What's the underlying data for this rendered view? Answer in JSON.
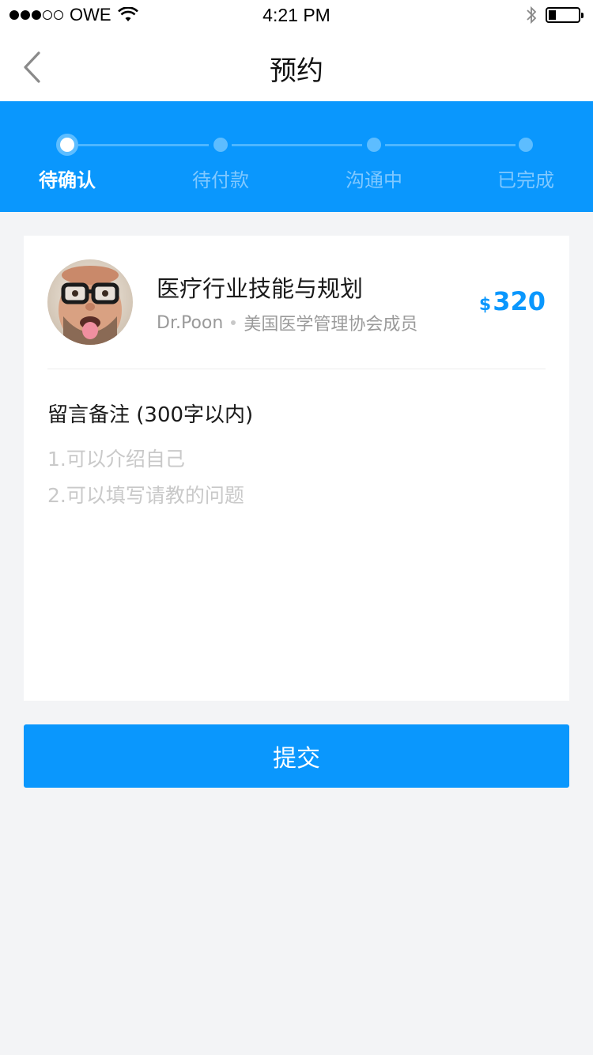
{
  "status_bar": {
    "carrier": "OWE",
    "time": "4:21 PM",
    "signal_filled": 3,
    "signal_total": 5,
    "battery_level": 0.25
  },
  "nav": {
    "title": "预约",
    "back_icon": "chevron-left-icon"
  },
  "steps": {
    "items": [
      {
        "label": "待确认",
        "active": true
      },
      {
        "label": "待付款",
        "active": false
      },
      {
        "label": "沟通中",
        "active": false
      },
      {
        "label": "已完成",
        "active": false
      }
    ],
    "active_color": "#ffffff",
    "inactive_color": "#7fc8ff",
    "bg_color": "#0a97fd"
  },
  "service": {
    "title": "医疗行业技能与规划",
    "doctor_name": "Dr.Poon",
    "doctor_desc": "美国医学管理协会成员",
    "price_currency": "$",
    "price_value": "320"
  },
  "notes": {
    "label": "留言备注 (300字以内)",
    "placeholder": "1.可以介绍自己\n2.可以填写请教的问题"
  },
  "submit_label": "提交",
  "colors": {
    "accent": "#0a97fd",
    "page_bg": "#f3f4f6"
  }
}
